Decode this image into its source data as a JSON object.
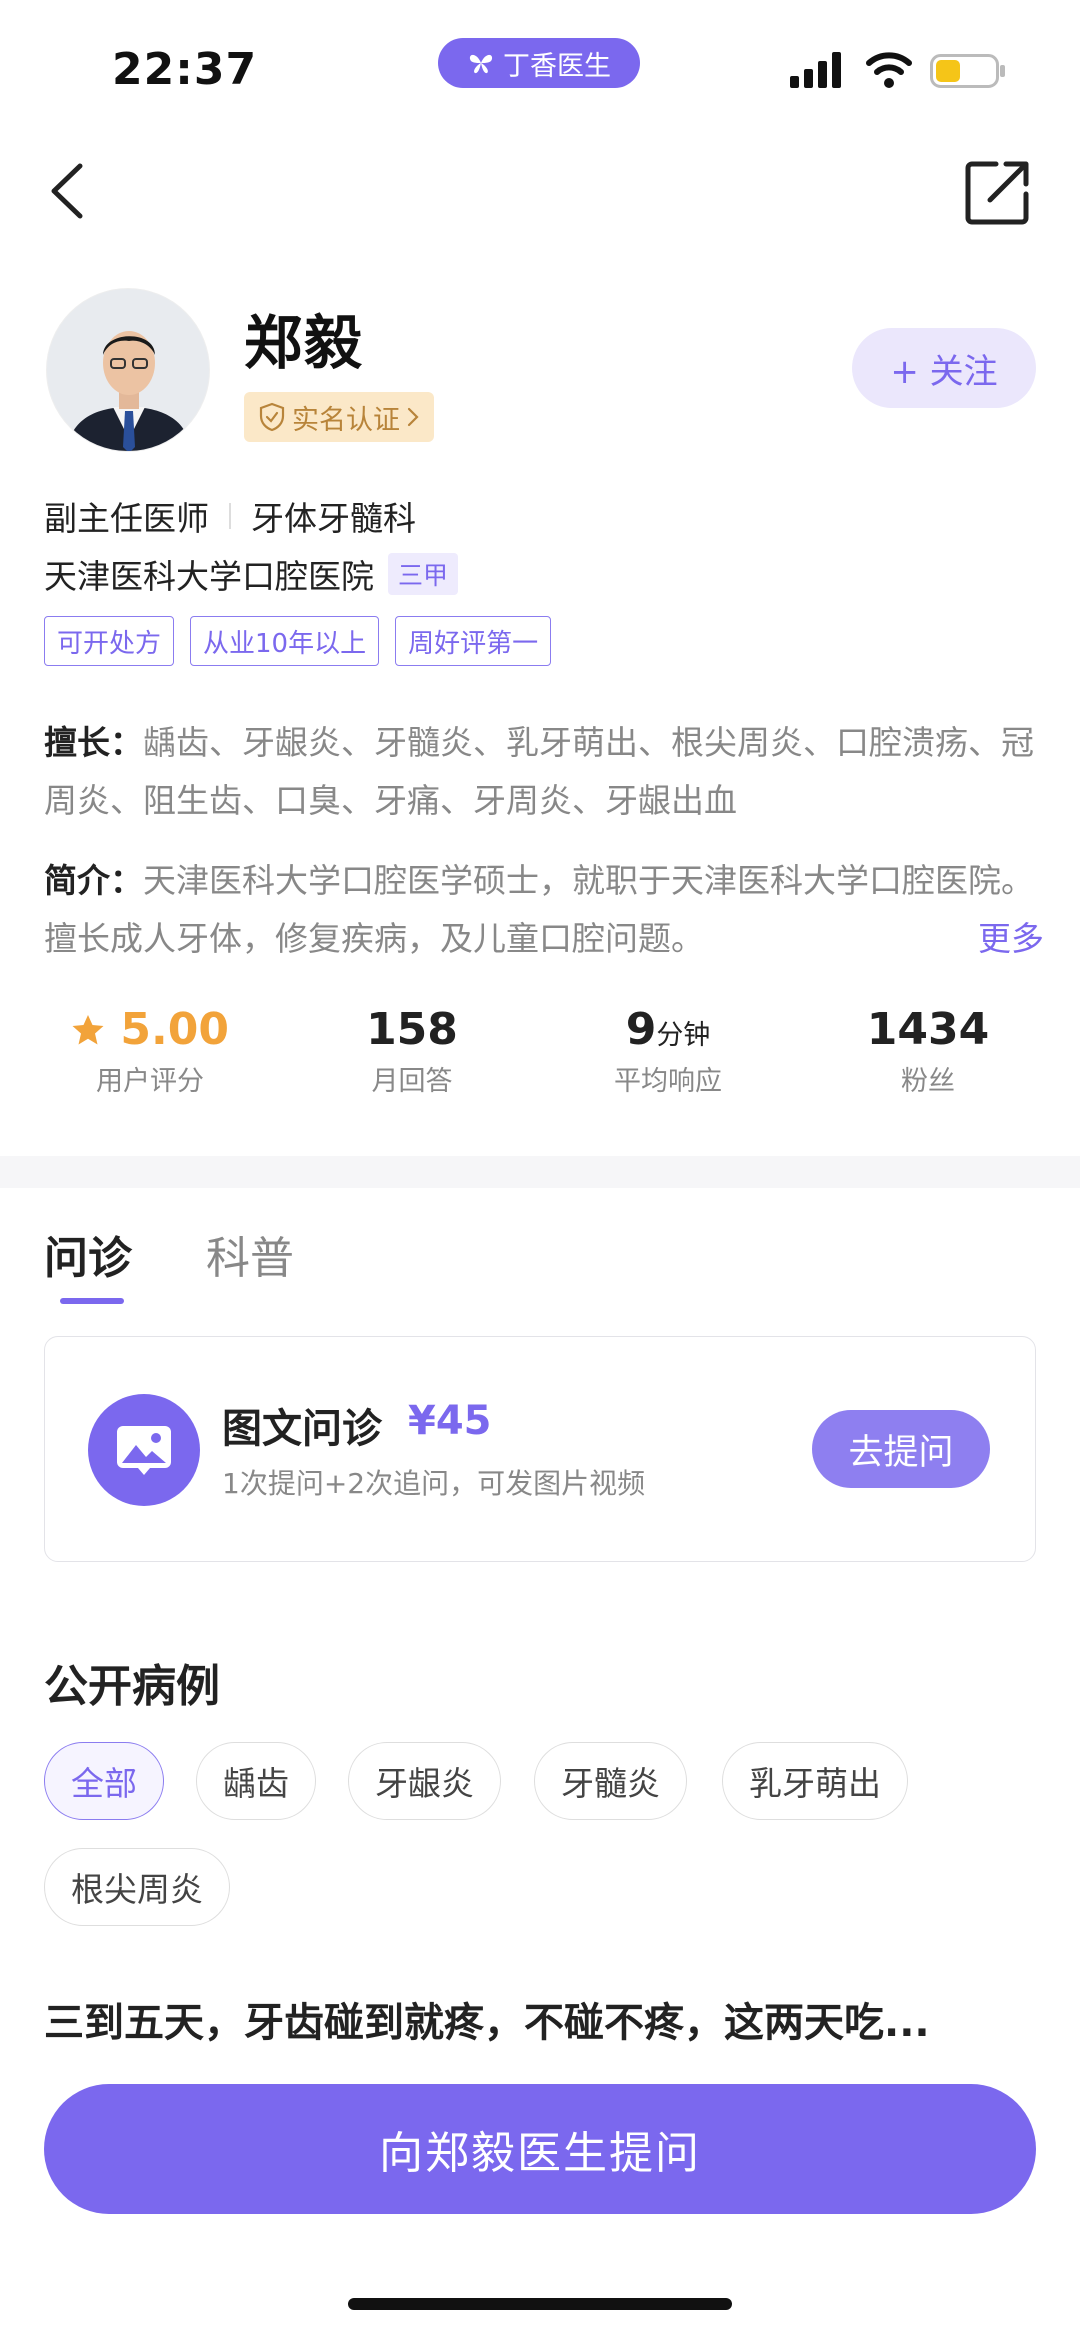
{
  "status_bar": {
    "time": "22:37",
    "brand": "丁香医生"
  },
  "doctor": {
    "name": "郑毅",
    "verify": "实名认证",
    "follow_label": "+ 关注",
    "title": "副主任医师",
    "department": "牙体牙髓科",
    "hospital": "天津医科大学口腔医院",
    "hospital_grade": "三甲",
    "tags": [
      "可开处方",
      "从业10年以上",
      "周好评第一"
    ],
    "specialty_label": "擅长：",
    "specialty": "龋齿、牙龈炎、牙髓炎、乳牙萌出、根尖周炎、口腔溃疡、冠周炎、阻生齿、口臭、牙痛、牙周炎、牙龈出血",
    "intro_label": "简介：",
    "intro": "天津医科大学口腔医学硕士，就职于天津医科大学口腔医院。擅长成人牙体，修复疾病，及儿童口腔问题。",
    "intro_more": "更多"
  },
  "stats": {
    "rating": "5.00",
    "rating_label": "用户评分",
    "monthly_answers": "158",
    "monthly_answers_label": "月回答",
    "response": "9",
    "response_unit": "分钟",
    "response_label": "平均响应",
    "fans": "1434",
    "fans_label": "粉丝"
  },
  "tabs": [
    "问诊",
    "科普"
  ],
  "consult": {
    "title": "图文问诊",
    "price": "¥45",
    "desc": "1次提问+2次追问，可发图片视频",
    "button": "去提问"
  },
  "cases": {
    "title": "公开病例",
    "filters": [
      "全部",
      "龋齿",
      "牙龈炎",
      "牙髓炎",
      "乳牙萌出",
      "根尖周炎"
    ],
    "first_case": "三到五天，牙齿碰到就疼，不碰不疼，这两天吃..."
  },
  "cta": "向郑毅医生提问",
  "colors": {
    "accent": "#7b68ee",
    "star": "#f2a33a",
    "verify_bg": "#fbe8c8"
  }
}
